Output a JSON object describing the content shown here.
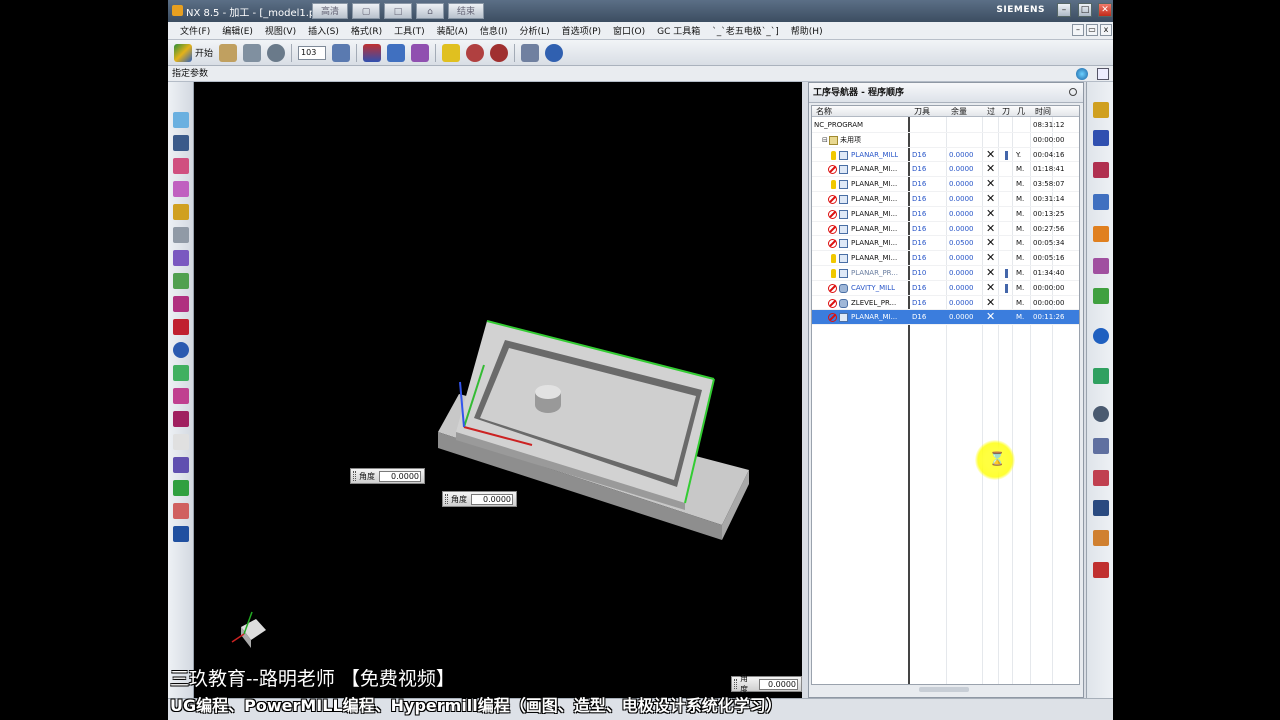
{
  "window": {
    "title": "NX 8.5 - 加工 - [_model1.prt",
    "tabs": [
      "高清",
      "结束"
    ],
    "brand": "SIEMENS"
  },
  "menu": [
    "文件(F)",
    "编辑(E)",
    "视图(V)",
    "插入(S)",
    "格式(R)",
    "工具(T)",
    "装配(A)",
    "信息(I)",
    "分析(L)",
    "首选项(P)",
    "窗口(O)",
    "GC 工具箱",
    "`_`老五电极`_`]",
    "帮助(H)"
  ],
  "toolbar": {
    "start_label": "开始",
    "combo_value": "103"
  },
  "param_bar": {
    "label": "指定参数"
  },
  "viewport": {
    "angle_label": "角度",
    "angle_values": [
      "0.0000",
      "0.0000",
      "0.0000"
    ]
  },
  "overlay": {
    "line1": "三玖教育--路明老师   【免费视频】",
    "line2": "UG编程、PowerMILL编程、Hypermill编程（画图、造型、电极设计系统化学习）"
  },
  "navigator": {
    "title": "工序导航器 - 程序顺序",
    "columns": [
      "名称",
      "刀具",
      "余量",
      "过",
      "刀",
      "几",
      "时间"
    ],
    "program": {
      "name": "NC_PROGRAM",
      "time": "08:31:12"
    },
    "group": {
      "name": "未用项",
      "time": "00:00:00"
    },
    "operations": [
      {
        "status": "warn",
        "name": "PLANAR_MILL",
        "tool": "D16",
        "stock": "0.0000",
        "geom": "Y.",
        "time": "00:04:16",
        "path": true,
        "name_style": "blue",
        "op_type": "planar"
      },
      {
        "status": "block",
        "name": "PLANAR_MI...",
        "tool": "D16",
        "stock": "0.0000",
        "geom": "M.",
        "time": "01:18:41",
        "path": false,
        "name_style": "normal",
        "op_type": "planar"
      },
      {
        "status": "warn",
        "name": "PLANAR_MI...",
        "tool": "D16",
        "stock": "0.0000",
        "geom": "M.",
        "time": "03:58:07",
        "path": false,
        "name_style": "normal",
        "op_type": "planar"
      },
      {
        "status": "block",
        "name": "PLANAR_MI...",
        "tool": "D16",
        "stock": "0.0000",
        "geom": "M.",
        "time": "00:31:14",
        "path": false,
        "name_style": "normal",
        "op_type": "planar"
      },
      {
        "status": "block",
        "name": "PLANAR_MI...",
        "tool": "D16",
        "stock": "0.0000",
        "geom": "M.",
        "time": "00:13:25",
        "path": false,
        "name_style": "normal",
        "op_type": "planar"
      },
      {
        "status": "block",
        "name": "PLANAR_MI...",
        "tool": "D16",
        "stock": "0.0000",
        "geom": "M.",
        "time": "00:27:56",
        "path": false,
        "name_style": "normal",
        "op_type": "planar"
      },
      {
        "status": "block",
        "name": "PLANAR_MI...",
        "tool": "D16",
        "stock": "0.0500",
        "geom": "M.",
        "time": "00:05:34",
        "path": false,
        "name_style": "normal",
        "op_type": "planar"
      },
      {
        "status": "warn",
        "name": "PLANAR_MI...",
        "tool": "D16",
        "stock": "0.0000",
        "geom": "M.",
        "time": "00:05:16",
        "path": false,
        "name_style": "normal",
        "op_type": "planar"
      },
      {
        "status": "warn",
        "name": "PLANAR_PR...",
        "tool": "D10",
        "stock": "0.0000",
        "geom": "M.",
        "time": "01:34:40",
        "path": true,
        "name_style": "dim",
        "op_type": "planar"
      },
      {
        "status": "block",
        "name": "CAVITY_MILL",
        "tool": "D16",
        "stock": "0.0000",
        "geom": "M.",
        "time": "00:00:00",
        "path": true,
        "name_style": "blue",
        "op_type": "cavity"
      },
      {
        "status": "block",
        "name": "ZLEVEL_PR...",
        "tool": "D16",
        "stock": "0.0000",
        "geom": "M.",
        "time": "00:00:00",
        "path": false,
        "name_style": "normal",
        "op_type": "cavity"
      },
      {
        "status": "block",
        "name": "PLANAR_MI...",
        "tool": "D16",
        "stock": "0.0000",
        "geom": "M.",
        "time": "00:11:26",
        "path": false,
        "name_style": "normal",
        "op_type": "planar",
        "selected": true
      }
    ]
  },
  "colors": {
    "titlebar": "#3c4d61",
    "selection": "#3b7ddd",
    "blocked": "#d11111",
    "warning": "#f0c800",
    "model_edge": "#33cc33",
    "cursor_halo": "#ffff40"
  },
  "icons": {
    "hourglass": "⌛"
  }
}
